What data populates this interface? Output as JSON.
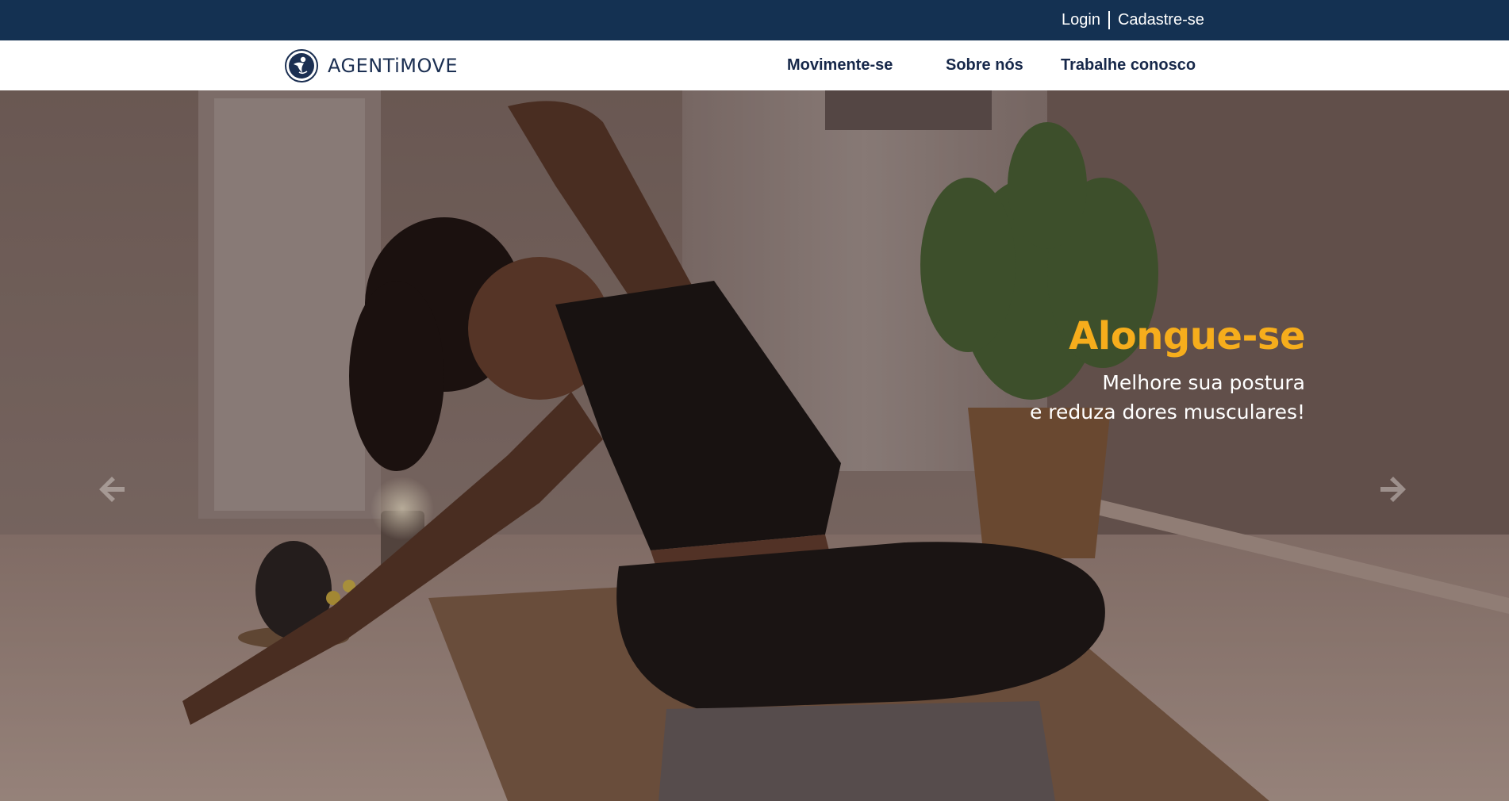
{
  "topbar": {
    "login_label": "Login",
    "signup_label": "Cadastre-se",
    "background_color": "#143152"
  },
  "navbar": {
    "logo_text": "AGENTiMOVE",
    "links": [
      {
        "label": "Movimente-se"
      },
      {
        "label": "Sobre nós"
      },
      {
        "label": "Trabalhe conosco"
      }
    ]
  },
  "hero": {
    "headline": "Alongue-se",
    "subtitle_line1": "Melhore sua postura",
    "subtitle_line2": "e reduza dores musculares!",
    "headline_color": "#f6ad1c",
    "prev_icon": "arrow-left-icon",
    "next_icon": "arrow-right-icon"
  }
}
